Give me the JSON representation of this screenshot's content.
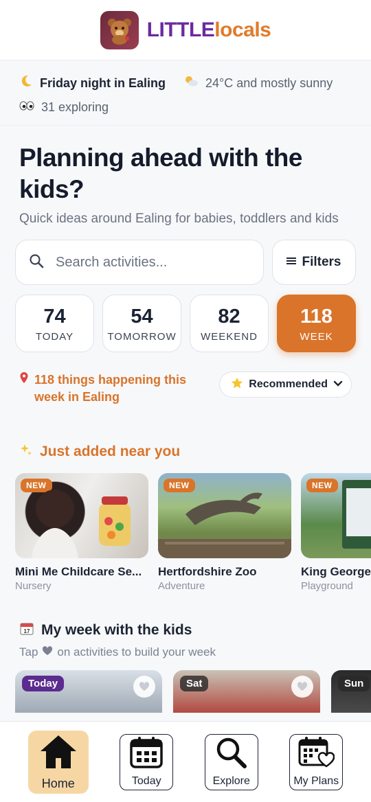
{
  "brand": {
    "little": "LITTLE",
    "locals": "locals"
  },
  "status": {
    "moon_icon": "moon-icon",
    "context": "Friday night in Ealing",
    "weather_icon": "sun-cloud-icon",
    "weather": "24°C and mostly sunny",
    "eyes_icon": "eyes-icon",
    "exploring": "31 exploring"
  },
  "hero": {
    "title": "Planning ahead with the kids?",
    "subtitle": "Quick ideas around Ealing for babies, toddlers and kids"
  },
  "search": {
    "placeholder": "Search activities...",
    "filters_label": "Filters"
  },
  "chips": [
    {
      "count": "74",
      "label": "TODAY"
    },
    {
      "count": "54",
      "label": "TOMORROW"
    },
    {
      "count": "82",
      "label": "WEEKEND"
    },
    {
      "count": "118",
      "label": "WEEK"
    }
  ],
  "results": {
    "text": "118 things happening this week in Ealing",
    "sort_label": "Recommended"
  },
  "just_added": {
    "heading": "Just added near you",
    "badge": "NEW",
    "cards": [
      {
        "title": "Mini Me Childcare Se...",
        "category": "Nursery"
      },
      {
        "title": "Hertfordshire Zoo",
        "category": "Adventure"
      },
      {
        "title": "King George",
        "category": "Playground"
      }
    ]
  },
  "my_week": {
    "heading": "My week with the kids",
    "note_before": "Tap",
    "note_after": "on activities to build your week",
    "days": [
      "Today",
      "Sat",
      "Sun"
    ]
  },
  "nav": {
    "home": "Home",
    "today": "Today",
    "explore": "Explore",
    "plans": "My Plans"
  },
  "colors": {
    "accent": "#d9742a",
    "purple": "#6b2aa0",
    "text": "#1c2434"
  }
}
